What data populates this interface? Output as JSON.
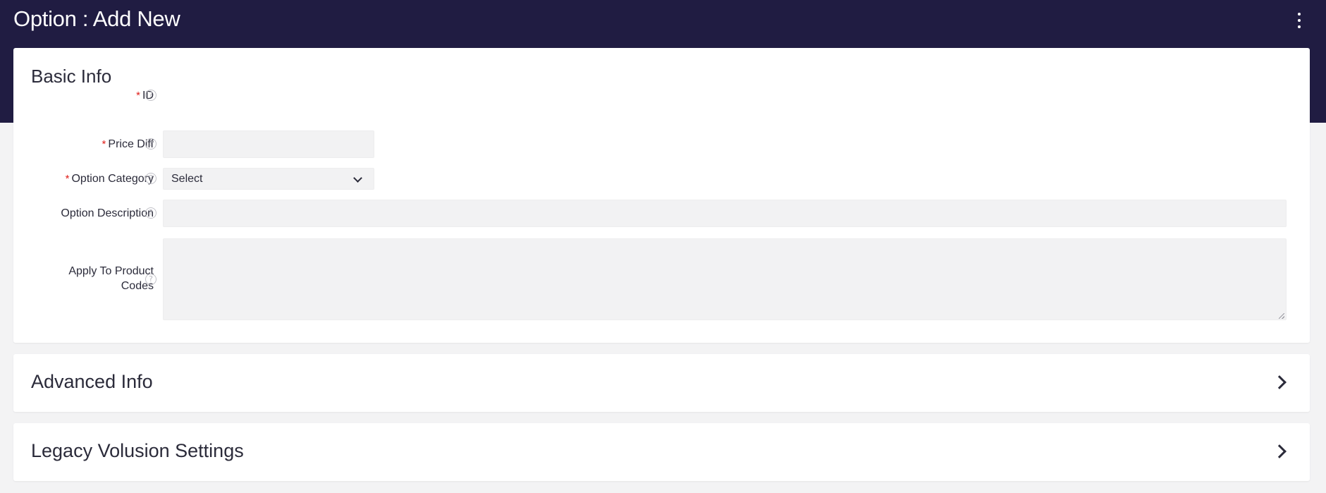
{
  "header": {
    "title": "Option : Add New",
    "menu_icon": "kebab-menu-icon"
  },
  "basic_info": {
    "title": "Basic Info",
    "required_marker": "*",
    "help_glyph": "?",
    "fields": {
      "id": {
        "label": "ID",
        "required": true,
        "value": ""
      },
      "price_diff": {
        "label": "Price Diff",
        "required": true,
        "value": ""
      },
      "option_category": {
        "label": "Option Category",
        "required": true,
        "selected": "Select"
      },
      "option_description": {
        "label": "Option Description",
        "required": false,
        "value": ""
      },
      "apply_to_product_codes": {
        "label_line1": "Apply To Product",
        "label_line2": "Codes",
        "required": false,
        "value": ""
      }
    }
  },
  "sections": {
    "advanced_info": {
      "title": "Advanced Info",
      "expanded": false
    },
    "legacy_volusion_settings": {
      "title": "Legacy Volusion Settings",
      "expanded": false
    }
  },
  "colors": {
    "header_bg": "#201c42",
    "page_bg": "#f3f3f4",
    "required": "#e0201c",
    "input_bg": "#f2f2f3"
  }
}
